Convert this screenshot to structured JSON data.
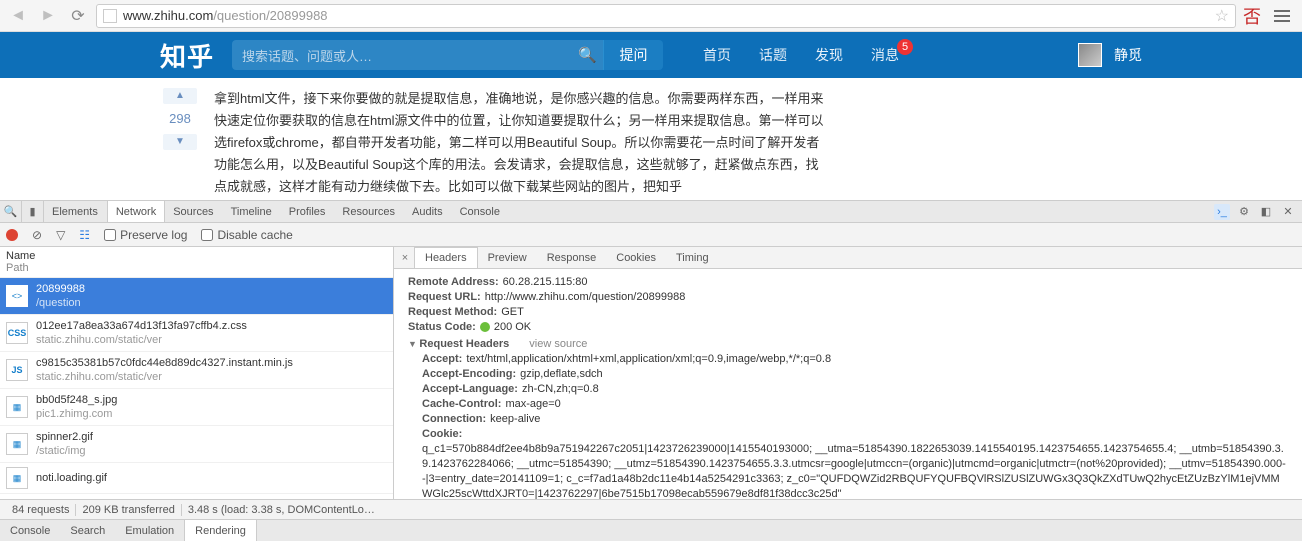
{
  "browser": {
    "url_domain": "www.zhihu.com",
    "url_path": "/question/20899988"
  },
  "zhihu": {
    "logo": "知乎",
    "search_placeholder": "搜索话题、问题或人…",
    "ask": "提问",
    "nav": [
      "首页",
      "话题",
      "发现",
      "消息"
    ],
    "msg_badge": "5",
    "username": "静觅",
    "vote_count": "298",
    "answer_text": "拿到html文件，接下来你要做的就是提取信息，准确地说，是你感兴趣的信息。你需要两样东西，一样用来快速定位你要获取的信息在html源文件中的位置，让你知道要提取什么；另一样用来提取信息。第一样可以选firefox或chrome，都自带开发者功能，第二样可以用Beautiful Soup。所以你需要花一点时间了解开发者功能怎么用，以及Beautiful Soup这个库的用法。会发请求，会提取信息，这些就够了，赶紧做点东西，找点成就感，这样才能有动力继续做下去。比如可以做下载某些网站的图片，把知乎"
  },
  "devtools": {
    "tabs": [
      "Elements",
      "Network",
      "Sources",
      "Timeline",
      "Profiles",
      "Resources",
      "Audits",
      "Console"
    ],
    "active_tab": "Network",
    "toolbar": {
      "preserve_log": "Preserve log",
      "disable_cache": "Disable cache"
    },
    "list_header_name": "Name",
    "list_header_path": "Path",
    "requests": [
      {
        "icon": "<>",
        "name": "20899988",
        "path": "/question",
        "sel": true
      },
      {
        "icon": "CSS",
        "name": "012ee17a8ea33a674d13f13fa97cffb4.z.css",
        "path": "static.zhihu.com/static/ver"
      },
      {
        "icon": "JS",
        "name": "c9815c35381b57c0fdc44e8d89dc4327.instant.min.js",
        "path": "static.zhihu.com/static/ver"
      },
      {
        "icon": "IMG",
        "name": "bb0d5f248_s.jpg",
        "path": "pic1.zhimg.com"
      },
      {
        "icon": "IMG",
        "name": "spinner2.gif",
        "path": "/static/img"
      },
      {
        "icon": "IMG",
        "name": "noti.loading.gif",
        "path": ""
      }
    ],
    "detail_tabs": [
      "Headers",
      "Preview",
      "Response",
      "Cookies",
      "Timing"
    ],
    "active_detail_tab": "Headers",
    "headers": {
      "remote_addr_k": "Remote Address:",
      "remote_addr_v": "60.28.215.115:80",
      "req_url_k": "Request URL:",
      "req_url_v": "http://www.zhihu.com/question/20899988",
      "req_method_k": "Request Method:",
      "req_method_v": "GET",
      "status_k": "Status Code:",
      "status_v": "200 OK",
      "section_req_headers": "Request Headers",
      "view_source": "view source",
      "accept_k": "Accept:",
      "accept_v": "text/html,application/xhtml+xml,application/xml;q=0.9,image/webp,*/*;q=0.8",
      "accept_enc_k": "Accept-Encoding:",
      "accept_enc_v": "gzip,deflate,sdch",
      "accept_lang_k": "Accept-Language:",
      "accept_lang_v": "zh-CN,zh;q=0.8",
      "cache_k": "Cache-Control:",
      "cache_v": "max-age=0",
      "conn_k": "Connection:",
      "conn_v": "keep-alive",
      "cookie_k": "Cookie:",
      "cookie_v": "q_c1=570b884df2ee4b8b9a751942267c2051|1423726239000|1415540193000; __utma=51854390.1822653039.1415540195.1423754655.1423754655.4; __utmb=51854390.3.9.1423762284066; __utmc=51854390; __utmz=51854390.1423754655.3.3.utmcsr=google|utmccn=(organic)|utmcmd=organic|utmctr=(not%20provided); __utmv=51854390.000--|3=entry_date=20141109=1; c_c=f7ad1a48b2dc11e4b14a5254291c3363; z_c0=\"QUFDQWZid2RBQUFYQUFBQVlRSlZUSlZUWGx3Q3QkZXdTUwQ2hycEtZUzBzYlM1ejVMMWGlc25scWttdXJRT0=|1423762297|6be7515b17098ecab559679e8df81f38dcc3c25d\""
    },
    "status_bar": {
      "requests": "84 requests",
      "transferred": "209 KB transferred",
      "timing": "3.48 s (load: 3.38 s, DOMContentLo…"
    },
    "drawer_tabs": [
      "Console",
      "Search",
      "Emulation",
      "Rendering"
    ],
    "active_drawer": "Rendering"
  }
}
